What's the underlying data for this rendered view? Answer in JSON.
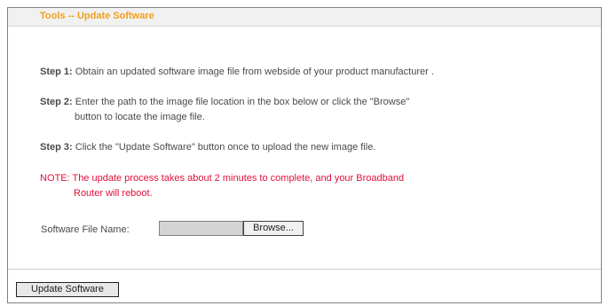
{
  "header": {
    "title": "Tools -- Update Software"
  },
  "steps": [
    {
      "label": "Step 1:",
      "text": "Obtain an updated software image file from webside of your product manufacturer .",
      "text2": ""
    },
    {
      "label": "Step 2:",
      "text": "Enter the path to the image file location in the box below or click the \"Browse\"",
      "text2": "button to locate the image file."
    },
    {
      "label": "Step 3:",
      "text": "Click the \"Update Software\" button once to upload the new image file.",
      "text2": ""
    }
  ],
  "note": {
    "line1": "NOTE: The update process takes about 2 minutes to complete, and your Broadband",
    "line2": "Router will reboot."
  },
  "file": {
    "label": "Software File Name:",
    "value": "",
    "browse_label": "Browse..."
  },
  "actions": {
    "update_label": "Update Software"
  }
}
